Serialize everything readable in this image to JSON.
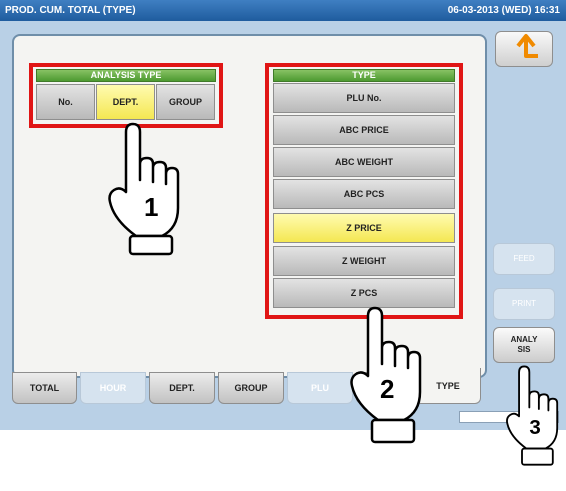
{
  "header": {
    "title": "PROD. CUM. TOTAL (TYPE)",
    "datetime": "06-03-2013 (WED) 16:31"
  },
  "analysis_type": {
    "title": "ANALYSIS TYPE",
    "options": [
      {
        "label": "No.",
        "selected": false
      },
      {
        "label": "DEPT.",
        "selected": true
      },
      {
        "label": "GROUP",
        "selected": false
      }
    ]
  },
  "type_panel": {
    "title": "TYPE",
    "options": [
      {
        "label": "PLU No.",
        "selected": false
      },
      {
        "label": "ABC PRICE",
        "selected": false
      },
      {
        "label": "ABC WEIGHT",
        "selected": false
      },
      {
        "label": "ABC PCS",
        "selected": false
      },
      {
        "label": "Z PRICE",
        "selected": true
      },
      {
        "label": "Z WEIGHT",
        "selected": false
      },
      {
        "label": "Z PCS",
        "selected": false
      }
    ]
  },
  "side_buttons": {
    "back_icon": "return-arrow-icon",
    "feed": "FEED",
    "print": "PRINT",
    "analysis": "ANALY SIS"
  },
  "tabs": [
    {
      "label": "TOTAL",
      "state": "normal"
    },
    {
      "label": "HOUR",
      "state": "disabled"
    },
    {
      "label": "DEPT.",
      "state": "normal"
    },
    {
      "label": "GROUP",
      "state": "normal"
    },
    {
      "label": "PLU",
      "state": "disabled"
    },
    {
      "label": "",
      "state": "normal"
    },
    {
      "label": "TYPE",
      "state": "active"
    }
  ],
  "callouts": {
    "step1": "1",
    "step2": "2",
    "step3": "3"
  },
  "colors": {
    "title_bar": "#2a6db0",
    "highlight": "#e01515",
    "selected": "#f4e752",
    "header_green": "#5ea83e"
  }
}
